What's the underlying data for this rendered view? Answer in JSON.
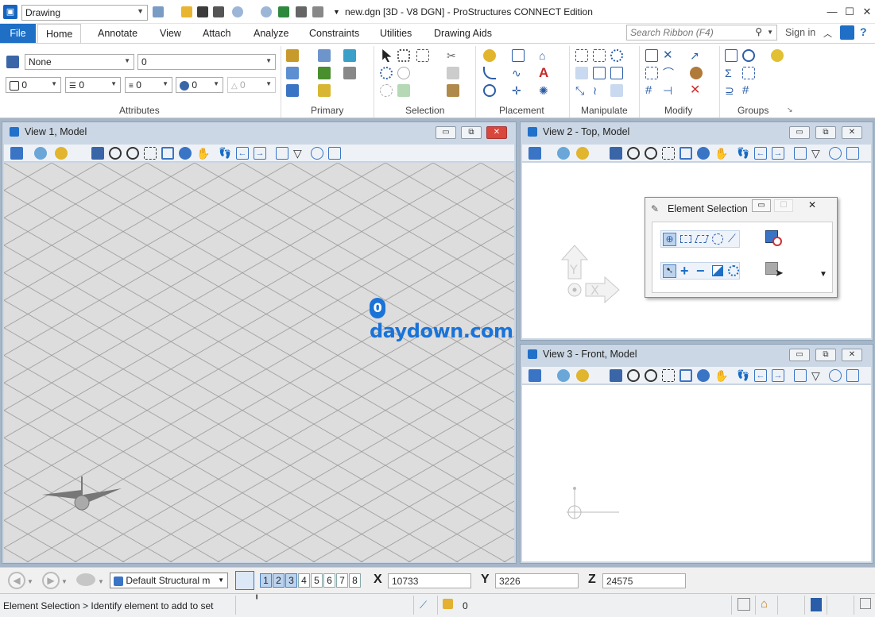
{
  "titlebar": {
    "workspace_value": "Drawing",
    "window_title": "new.dgn [3D - V8 DGN] - ProStructures CONNECT Edition",
    "min_glyph": "—",
    "max_glyph": "☐",
    "close_glyph": "✕"
  },
  "ribbon": {
    "tabs": [
      "File",
      "Home",
      "Annotate",
      "View",
      "Attach",
      "Analyze",
      "Constraints",
      "Utilities",
      "Drawing Aids"
    ],
    "search_placeholder": "Search Ribbon (F4)",
    "sign_in": "Sign in",
    "groups": [
      "Attributes",
      "Primary",
      "Selection",
      "Placement",
      "Manipulate",
      "Modify",
      "Groups"
    ],
    "attributes": {
      "level": "None",
      "text_style": "0",
      "color": "0",
      "linestyle": "0",
      "weight": "0",
      "class": "0",
      "transparency": "0"
    }
  },
  "views": [
    {
      "title": "View 1, Model"
    },
    {
      "title": "View 2 - Top, Model"
    },
    {
      "title": "View 3 - Front, Model"
    }
  ],
  "element_selection": {
    "title": "Element Selection"
  },
  "watermark": "daydown.com",
  "bottombar": {
    "template": "Default Structural m",
    "pages": [
      "1",
      "2",
      "3",
      "4",
      "5",
      "6",
      "7",
      "8"
    ],
    "x_label": "X",
    "x_value": "10733",
    "y_label": "Y",
    "y_value": "3226",
    "z_label": "Z",
    "z_value": "24575"
  },
  "statusbar": {
    "prompt": "Element Selection > Identify element to add to set",
    "active_value": "0"
  },
  "colors": {
    "file_tab": "#1e6fc5",
    "workspace_bg": "#a7b6c7",
    "view_frame": "#cbd7e4",
    "grid_bg": "#dddddd",
    "grid_line": "#9a9a9a"
  }
}
